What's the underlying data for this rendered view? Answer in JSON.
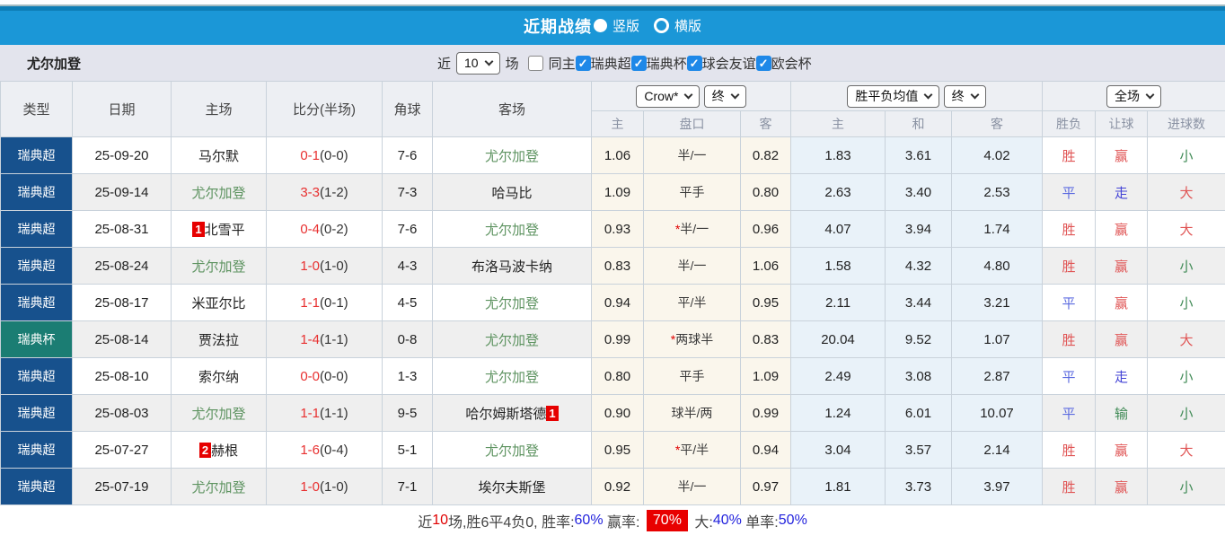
{
  "titlebar": {
    "title": "近期战绩",
    "vertical_label": "竖版",
    "horizontal_label": "横版"
  },
  "filterbar": {
    "team": "尤尔加登",
    "near_label": "近",
    "count_value": "10",
    "matches_label": "场",
    "same_home_label": "同主",
    "league_filters": [
      "瑞典超",
      "瑞典杯",
      "球会友谊",
      "欧会杯"
    ]
  },
  "table": {
    "headers": {
      "type": "类型",
      "date": "日期",
      "home": "主场",
      "score": "比分(半场)",
      "corners": "角球",
      "away": "客场",
      "odds_select": "Crow*",
      "odds_final_select": "终",
      "odds_sub": [
        "主",
        "盘口",
        "客"
      ],
      "avg_select": "胜平负均值",
      "avg_final_select": "终",
      "avg_sub": [
        "主",
        "和",
        "客"
      ],
      "fulltime_select": "全场",
      "result_sub": [
        "胜负",
        "让球",
        "进球数"
      ]
    },
    "rows": [
      {
        "league": "瑞典超",
        "league_class": "lg-blue",
        "date": "25-09-20",
        "home_badge_before": "",
        "home": "马尔默",
        "home_class": "",
        "home_badge_after": "",
        "score": "0-1",
        "half": "(0-0)",
        "corners": "7-6",
        "away_badge_before": "",
        "away": "尤尔加登",
        "away_class": "green",
        "away_badge_after": "",
        "odds_home": "1.06",
        "handicap_star": "",
        "handicap": "半/一",
        "odds_away": "0.82",
        "avg_home": "1.83",
        "avg_draw": "3.61",
        "avg_away": "4.02",
        "result": "胜",
        "result_class": "t-red",
        "handicap_result": "赢",
        "handicap_result_class": "t-red",
        "goals": "小",
        "goals_class": "t-green"
      },
      {
        "league": "瑞典超",
        "league_class": "lg-blue",
        "date": "25-09-14",
        "home_badge_before": "",
        "home": "尤尔加登",
        "home_class": "green",
        "home_badge_after": "",
        "score": "3-3",
        "half": "(1-2)",
        "corners": "7-3",
        "away_badge_before": "",
        "away": "哈马比",
        "away_class": "",
        "away_badge_after": "",
        "odds_home": "1.09",
        "handicap_star": "",
        "handicap": "平手",
        "odds_away": "0.80",
        "avg_home": "2.63",
        "avg_draw": "3.40",
        "avg_away": "2.53",
        "result": "平",
        "result_class": "t-blue",
        "handicap_result": "走",
        "handicap_result_class": "t-violet",
        "goals": "大",
        "goals_class": "t-red"
      },
      {
        "league": "瑞典超",
        "league_class": "lg-blue",
        "date": "25-08-31",
        "home_badge_before": "1",
        "home": "北雪平",
        "home_class": "",
        "home_badge_after": "",
        "score": "0-4",
        "half": "(0-2)",
        "corners": "7-6",
        "away_badge_before": "",
        "away": "尤尔加登",
        "away_class": "green",
        "away_badge_after": "",
        "odds_home": "0.93",
        "handicap_star": "*",
        "handicap": "半/一",
        "odds_away": "0.96",
        "avg_home": "4.07",
        "avg_draw": "3.94",
        "avg_away": "1.74",
        "result": "胜",
        "result_class": "t-red",
        "handicap_result": "赢",
        "handicap_result_class": "t-red",
        "goals": "大",
        "goals_class": "t-red"
      },
      {
        "league": "瑞典超",
        "league_class": "lg-blue",
        "date": "25-08-24",
        "home_badge_before": "",
        "home": "尤尔加登",
        "home_class": "green",
        "home_badge_after": "",
        "score": "1-0",
        "half": "(1-0)",
        "corners": "4-3",
        "away_badge_before": "",
        "away": "布洛马波卡纳",
        "away_class": "",
        "away_badge_after": "",
        "odds_home": "0.83",
        "handicap_star": "",
        "handicap": "半/一",
        "odds_away": "1.06",
        "avg_home": "1.58",
        "avg_draw": "4.32",
        "avg_away": "4.80",
        "result": "胜",
        "result_class": "t-red",
        "handicap_result": "赢",
        "handicap_result_class": "t-red",
        "goals": "小",
        "goals_class": "t-green"
      },
      {
        "league": "瑞典超",
        "league_class": "lg-blue",
        "date": "25-08-17",
        "home_badge_before": "",
        "home": "米亚尔比",
        "home_class": "",
        "home_badge_after": "",
        "score": "1-1",
        "half": "(0-1)",
        "corners": "4-5",
        "away_badge_before": "",
        "away": "尤尔加登",
        "away_class": "green",
        "away_badge_after": "",
        "odds_home": "0.94",
        "handicap_star": "",
        "handicap": "平/半",
        "odds_away": "0.95",
        "avg_home": "2.11",
        "avg_draw": "3.44",
        "avg_away": "3.21",
        "result": "平",
        "result_class": "t-blue",
        "handicap_result": "赢",
        "handicap_result_class": "t-red",
        "goals": "小",
        "goals_class": "t-green"
      },
      {
        "league": "瑞典杯",
        "league_class": "lg-cup",
        "date": "25-08-14",
        "home_badge_before": "",
        "home": "贾法拉",
        "home_class": "",
        "home_badge_after": "",
        "score": "1-4",
        "half": "(1-1)",
        "corners": "0-8",
        "away_badge_before": "",
        "away": "尤尔加登",
        "away_class": "green",
        "away_badge_after": "",
        "odds_home": "0.99",
        "handicap_star": "*",
        "handicap": "两球半",
        "odds_away": "0.83",
        "avg_home": "20.04",
        "avg_draw": "9.52",
        "avg_away": "1.07",
        "result": "胜",
        "result_class": "t-red",
        "handicap_result": "赢",
        "handicap_result_class": "t-red",
        "goals": "大",
        "goals_class": "t-red"
      },
      {
        "league": "瑞典超",
        "league_class": "lg-blue",
        "date": "25-08-10",
        "home_badge_before": "",
        "home": "索尔纳",
        "home_class": "",
        "home_badge_after": "",
        "score": "0-0",
        "half": "(0-0)",
        "corners": "1-3",
        "away_badge_before": "",
        "away": "尤尔加登",
        "away_class": "green",
        "away_badge_after": "",
        "odds_home": "0.80",
        "handicap_star": "",
        "handicap": "平手",
        "odds_away": "1.09",
        "avg_home": "2.49",
        "avg_draw": "3.08",
        "avg_away": "2.87",
        "result": "平",
        "result_class": "t-blue",
        "handicap_result": "走",
        "handicap_result_class": "t-violet",
        "goals": "小",
        "goals_class": "t-green"
      },
      {
        "league": "瑞典超",
        "league_class": "lg-blue",
        "date": "25-08-03",
        "home_badge_before": "",
        "home": "尤尔加登",
        "home_class": "green",
        "home_badge_after": "",
        "score": "1-1",
        "half": "(1-1)",
        "corners": "9-5",
        "away_badge_before": "",
        "away": "哈尔姆斯塔德",
        "away_class": "",
        "away_badge_after": "1",
        "odds_home": "0.90",
        "handicap_star": "",
        "handicap": "球半/两",
        "odds_away": "0.99",
        "avg_home": "1.24",
        "avg_draw": "6.01",
        "avg_away": "10.07",
        "result": "平",
        "result_class": "t-blue",
        "handicap_result": "输",
        "handicap_result_class": "t-green",
        "goals": "小",
        "goals_class": "t-green"
      },
      {
        "league": "瑞典超",
        "league_class": "lg-blue",
        "date": "25-07-27",
        "home_badge_before": "2",
        "home": "赫根",
        "home_class": "",
        "home_badge_after": "",
        "score": "1-6",
        "half": "(0-4)",
        "corners": "5-1",
        "away_badge_before": "",
        "away": "尤尔加登",
        "away_class": "green",
        "away_badge_after": "",
        "odds_home": "0.95",
        "handicap_star": "*",
        "handicap": "平/半",
        "odds_away": "0.94",
        "avg_home": "3.04",
        "avg_draw": "3.57",
        "avg_away": "2.14",
        "result": "胜",
        "result_class": "t-red",
        "handicap_result": "赢",
        "handicap_result_class": "t-red",
        "goals": "大",
        "goals_class": "t-red"
      },
      {
        "league": "瑞典超",
        "league_class": "lg-blue",
        "date": "25-07-19",
        "home_badge_before": "",
        "home": "尤尔加登",
        "home_class": "green",
        "home_badge_after": "",
        "score": "1-0",
        "half": "(1-0)",
        "corners": "7-1",
        "away_badge_before": "",
        "away": "埃尔夫斯堡",
        "away_class": "",
        "away_badge_after": "",
        "odds_home": "0.92",
        "handicap_star": "",
        "handicap": "半/一",
        "odds_away": "0.97",
        "avg_home": "1.81",
        "avg_draw": "3.73",
        "avg_away": "3.97",
        "result": "胜",
        "result_class": "t-red",
        "handicap_result": "赢",
        "handicap_result_class": "t-red",
        "goals": "小",
        "goals_class": "t-green"
      }
    ]
  },
  "summary": {
    "segments": [
      {
        "text": "近",
        "class": "s-dark"
      },
      {
        "text": "10",
        "class": "s-red"
      },
      {
        "text": "场,胜6平4负0, ",
        "class": "s-dark"
      },
      {
        "text": "胜率:",
        "class": "s-dark"
      },
      {
        "text": "60%",
        "class": "s-blue"
      },
      {
        "text": " 赢率: ",
        "class": "s-dark"
      },
      {
        "text": "70%",
        "class": "s-redbg"
      },
      {
        "text": " 大:",
        "class": "s-dark"
      },
      {
        "text": "40%",
        "class": "s-blue"
      },
      {
        "text": " 单率:",
        "class": "s-dark"
      },
      {
        "text": "50%",
        "class": "s-blue"
      }
    ]
  }
}
